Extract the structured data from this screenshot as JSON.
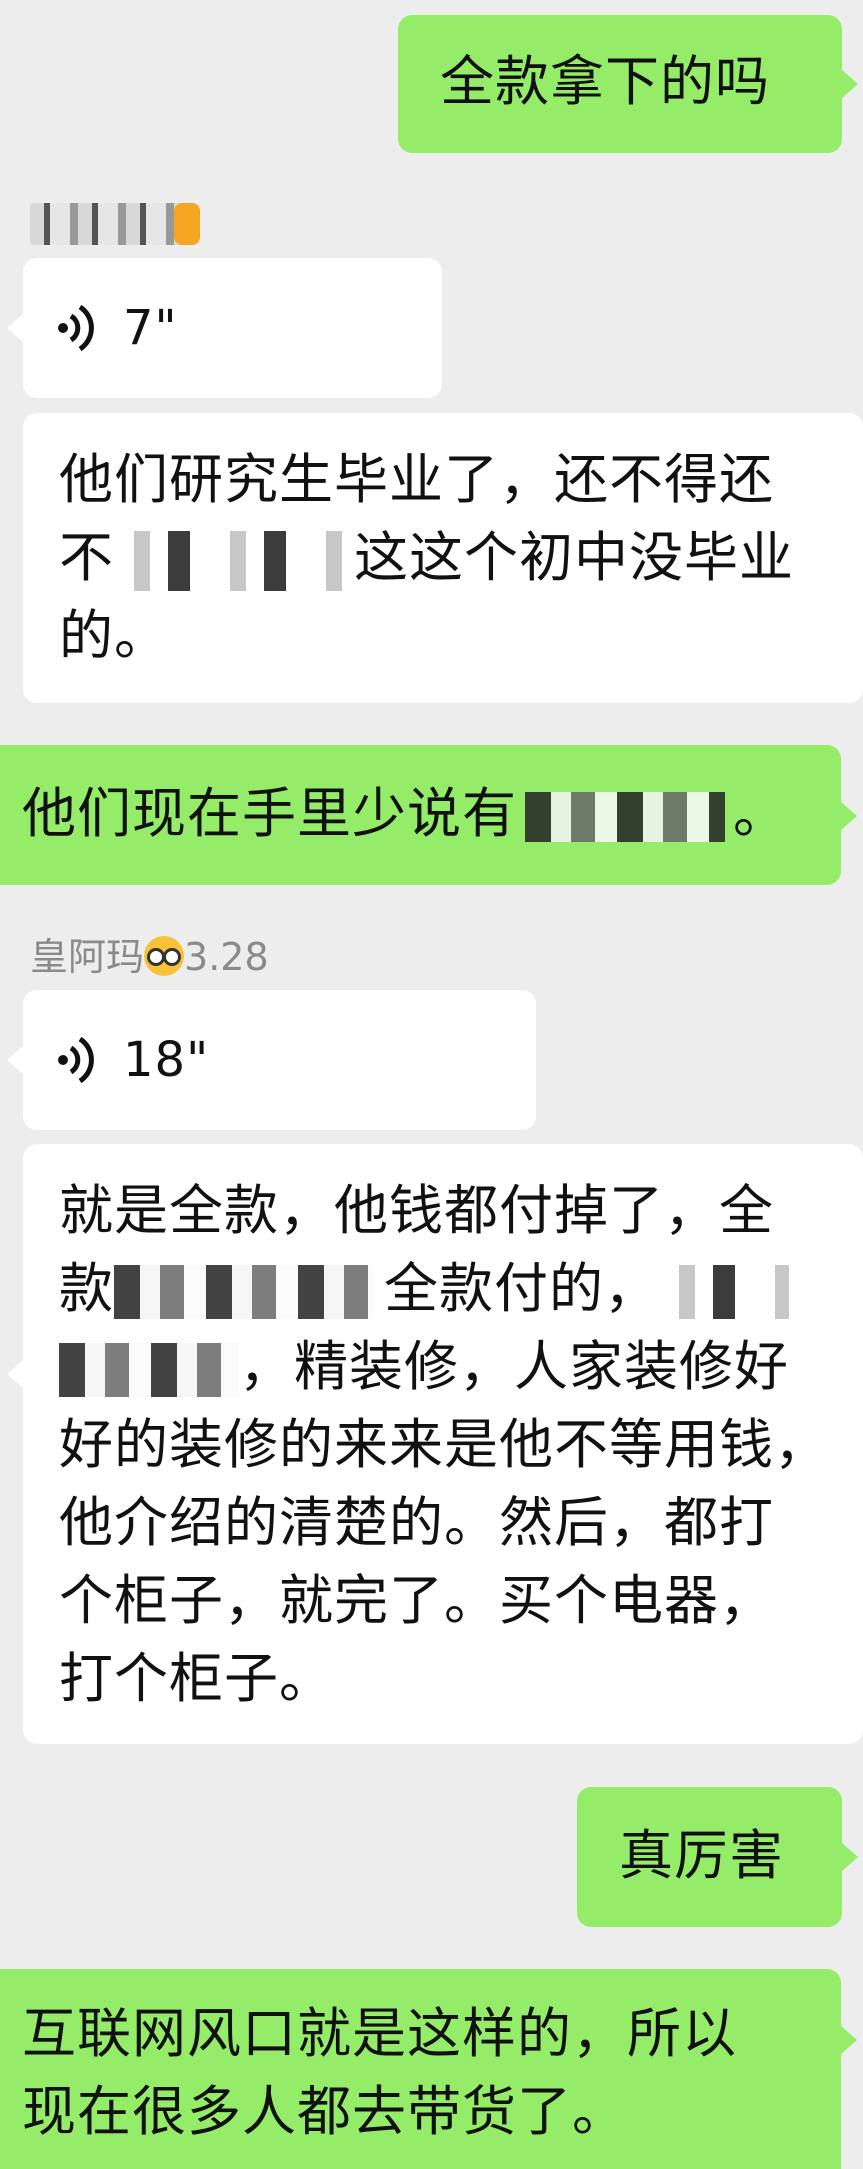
{
  "chat": {
    "messages": [
      {
        "id": "m1",
        "side": "sent",
        "text": "全款拿下的吗"
      },
      {
        "id": "m2",
        "side": "recv",
        "sender_blurred": true,
        "type": "voice",
        "duration": "7\""
      },
      {
        "id": "m3",
        "side": "recv",
        "type": "text",
        "line1": "他们研究生毕业了，还不得还",
        "line2_a": "不",
        "line2_b": "这这个初中没毕业",
        "line3": "的。"
      },
      {
        "id": "m4",
        "side": "sent",
        "text_a": "他们现在手里少说有",
        "text_b": "。"
      },
      {
        "id": "m5",
        "side": "recv",
        "sender": "皇阿玛",
        "sender_suffix": "3.28",
        "type": "voice",
        "duration": "18\""
      },
      {
        "id": "m6",
        "side": "recv",
        "type": "text",
        "line1": "就是全款，他钱都付掉了，全",
        "line2_a": "款",
        "line2_b": "全款付的，",
        "line3_b": "，精装修，人家装修好",
        "line4": "好的装修的来来是他不等用钱，",
        "line5": "他介绍的清楚的。然后，都打",
        "line6": "个柜子，就完了。买个电器，",
        "line7": "打个柜子。"
      },
      {
        "id": "m7",
        "side": "sent",
        "text": "真厉害"
      },
      {
        "id": "m8",
        "side": "sent",
        "line1": "互联网风口就是这样的，所以",
        "line2": "现在很多人都去带货了。"
      }
    ]
  },
  "colors": {
    "background": "#ededed",
    "sent_bubble": "#95ec69",
    "received_bubble": "#ffffff",
    "sender_name": "#8a8a8a"
  },
  "icons": {
    "voice": "voice-wave-icon",
    "emoji": "nerd-face-icon"
  }
}
